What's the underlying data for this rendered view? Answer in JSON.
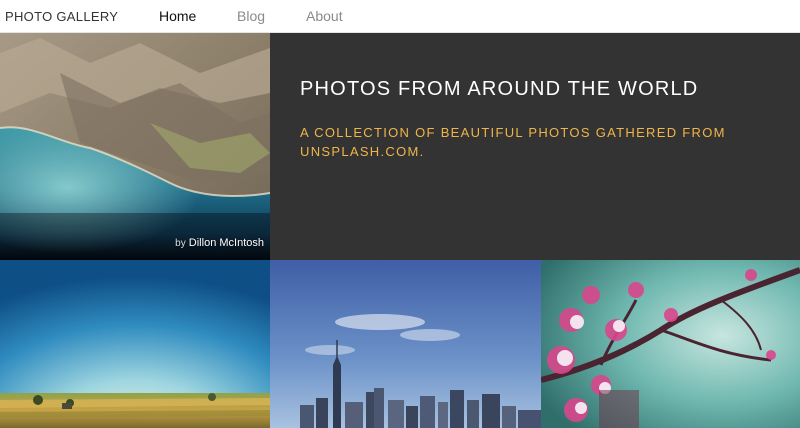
{
  "nav": {
    "brand": "PHOTO GALLERY",
    "links": [
      {
        "label": "Home",
        "active": true
      },
      {
        "label": "Blog",
        "active": false
      },
      {
        "label": "About",
        "active": false
      }
    ]
  },
  "hero": {
    "title": "PHOTOS FROM AROUND THE WORLD",
    "subtitle": "A COLLECTION OF BEAUTIFUL PHOTOS GATHERED FROM UNSPLASH.COM.",
    "photo_credit_prefix": "by",
    "photo_credit_name": "Dillon McIntosh"
  },
  "colors": {
    "panel_bg": "#333333",
    "subtitle_accent": "#f0b54a",
    "nav_active": "#111111",
    "nav_inactive": "#8a8a8a"
  }
}
